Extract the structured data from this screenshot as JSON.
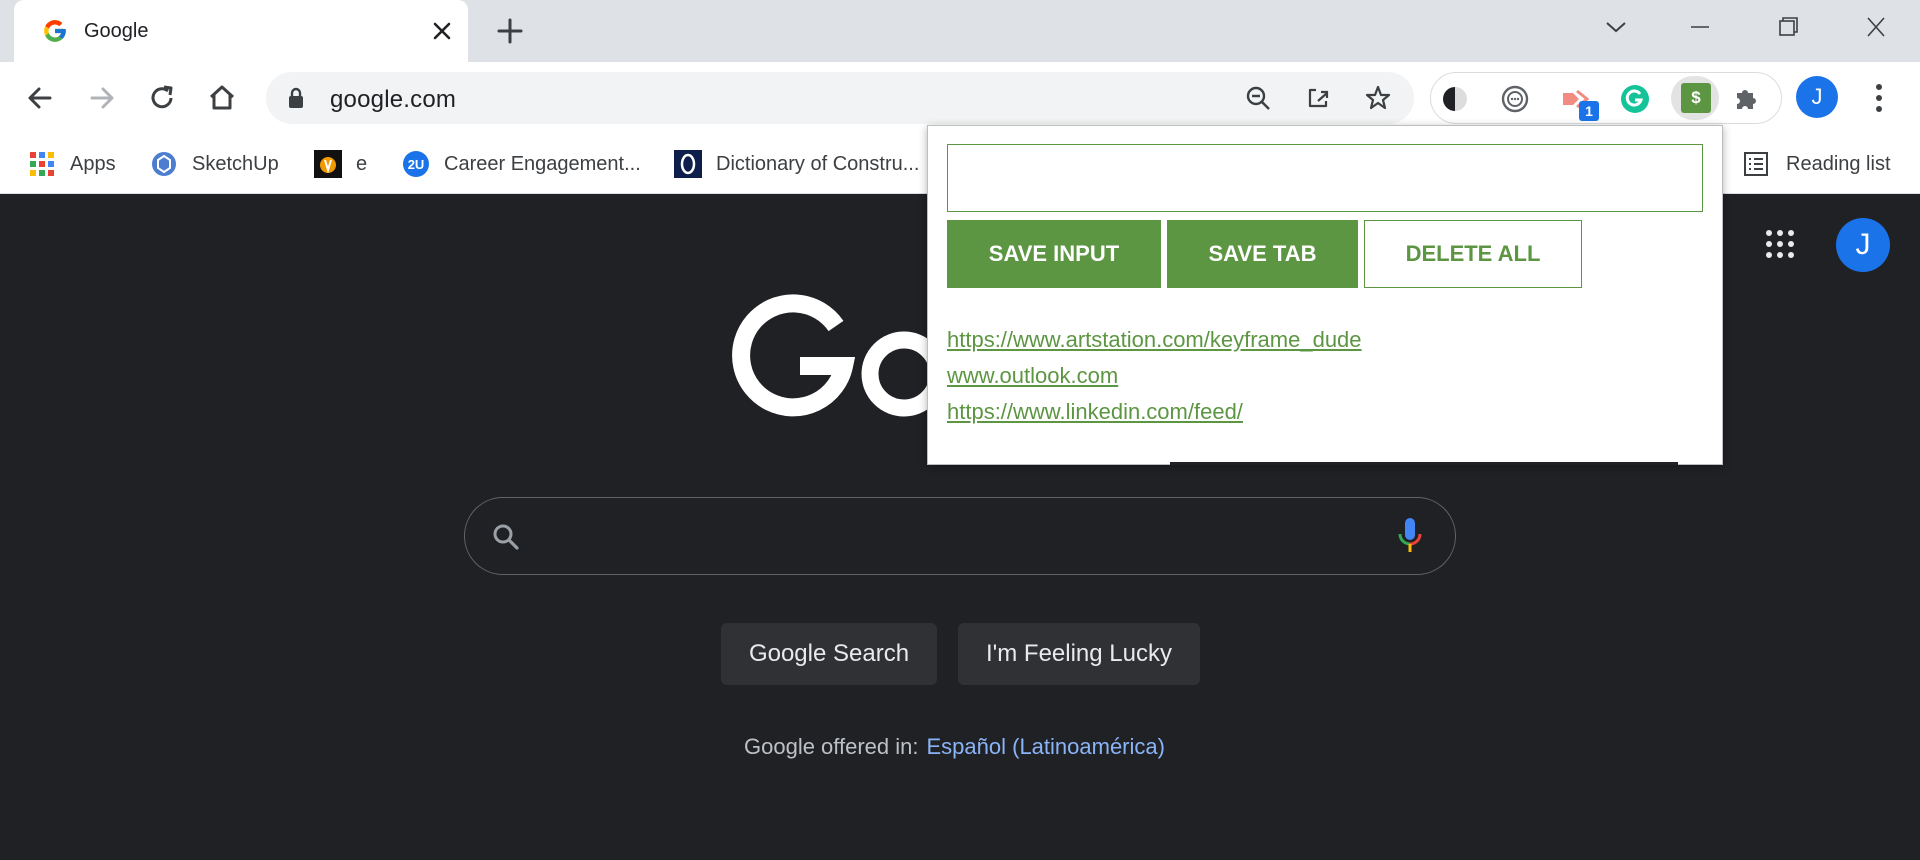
{
  "tab": {
    "title": "Google"
  },
  "omnibox": {
    "url": "google.com"
  },
  "extensions": {
    "badge_count": "1",
    "profile_initial": "J",
    "active_extension_label": "$"
  },
  "bookmarks": {
    "items": [
      {
        "label": "Apps"
      },
      {
        "label": "SketchUp"
      },
      {
        "label": "e"
      },
      {
        "label": "Career Engagement..."
      },
      {
        "label": "Dictionary of Constru..."
      }
    ],
    "reading_list": "Reading list"
  },
  "google": {
    "profile_initial": "J",
    "search_button": "Google Search",
    "lucky_button": "I'm Feeling Lucky",
    "offered_in": "Google offered in:",
    "language_link": "Español (Latinoamérica)"
  },
  "popup": {
    "input_value": "",
    "save_input": "SAVE INPUT",
    "save_tab": "SAVE TAB",
    "delete_all": "DELETE ALL",
    "links": [
      "https://www.artstation.com/keyframe_dude",
      "www.outlook.com",
      "https://www.linkedin.com/feed/"
    ],
    "accent_color": "#5d9643"
  }
}
